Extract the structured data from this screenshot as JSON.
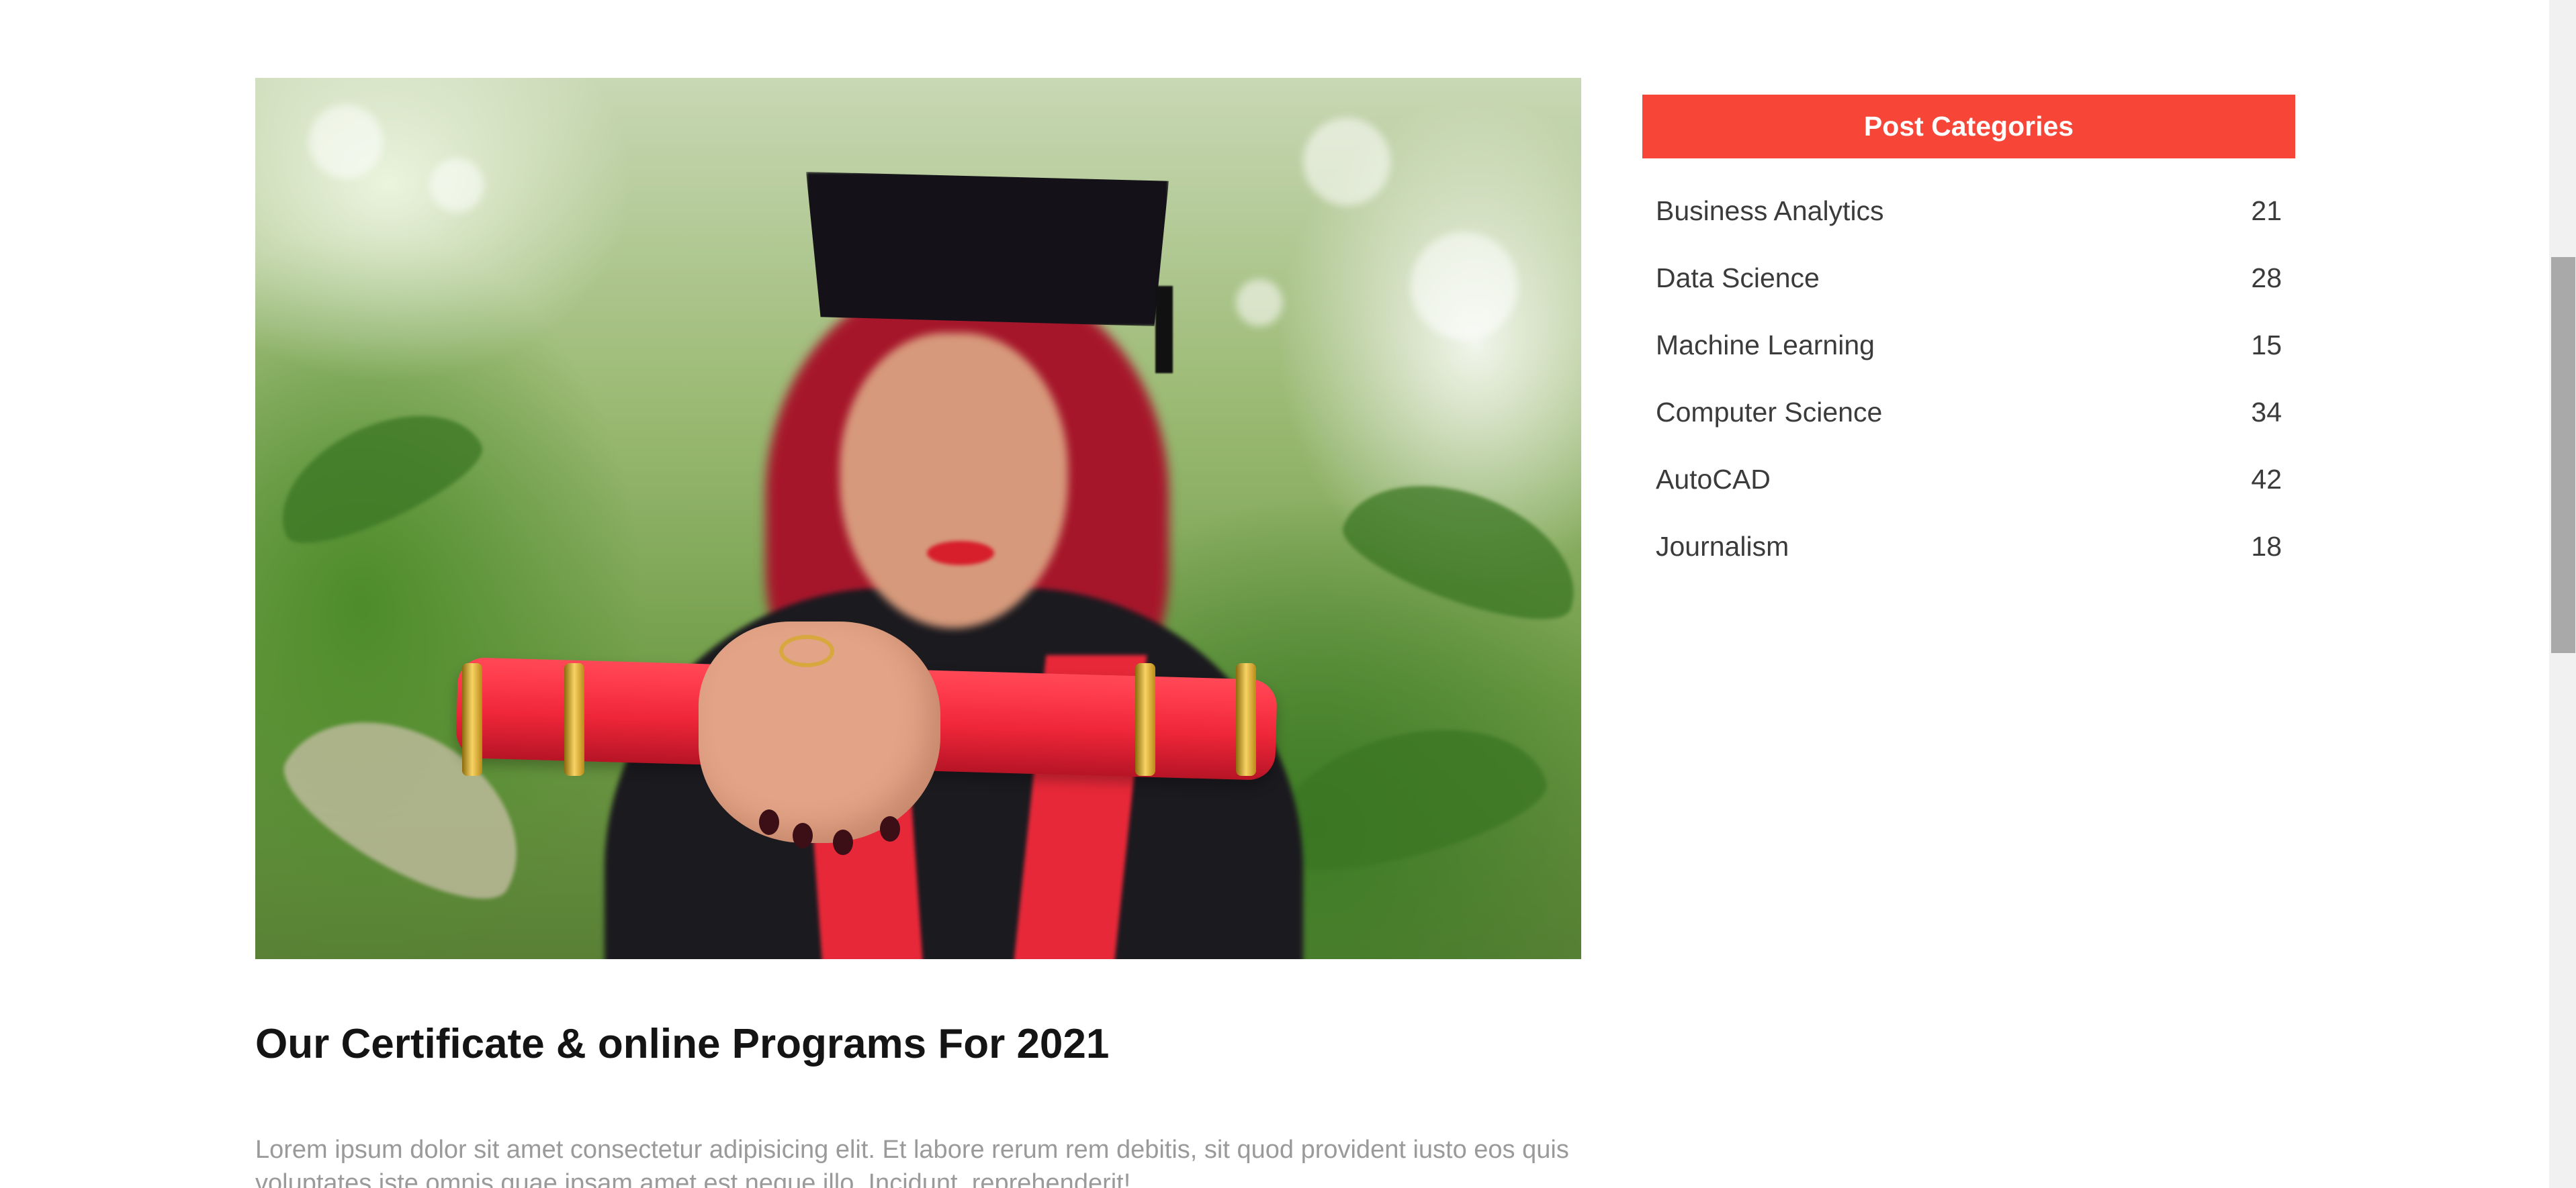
{
  "article": {
    "image_alt": "Graduate holding a red diploma scroll",
    "title": "Our Certificate & online Programs For 2021",
    "excerpt": "Lorem ipsum dolor sit amet consectetur adipisicing elit. Et labore rerum rem debitis, sit quod provident iusto eos quis voluptates iste omnis quae ipsam amet est neque illo. Incidunt, reprehenderit!"
  },
  "sidebar": {
    "heading": "Post Categories",
    "categories": [
      {
        "label": "Business Analytics",
        "count": "21"
      },
      {
        "label": "Data Science",
        "count": "28"
      },
      {
        "label": "Machine Learning",
        "count": "15"
      },
      {
        "label": "Computer Science",
        "count": "34"
      },
      {
        "label": "AutoCAD",
        "count": "42"
      },
      {
        "label": "Journalism",
        "count": "18"
      }
    ]
  },
  "colors": {
    "accent": "#f74538",
    "title_text": "#141414",
    "body_text": "#9a9a9a",
    "category_text": "#3b3b3b"
  }
}
